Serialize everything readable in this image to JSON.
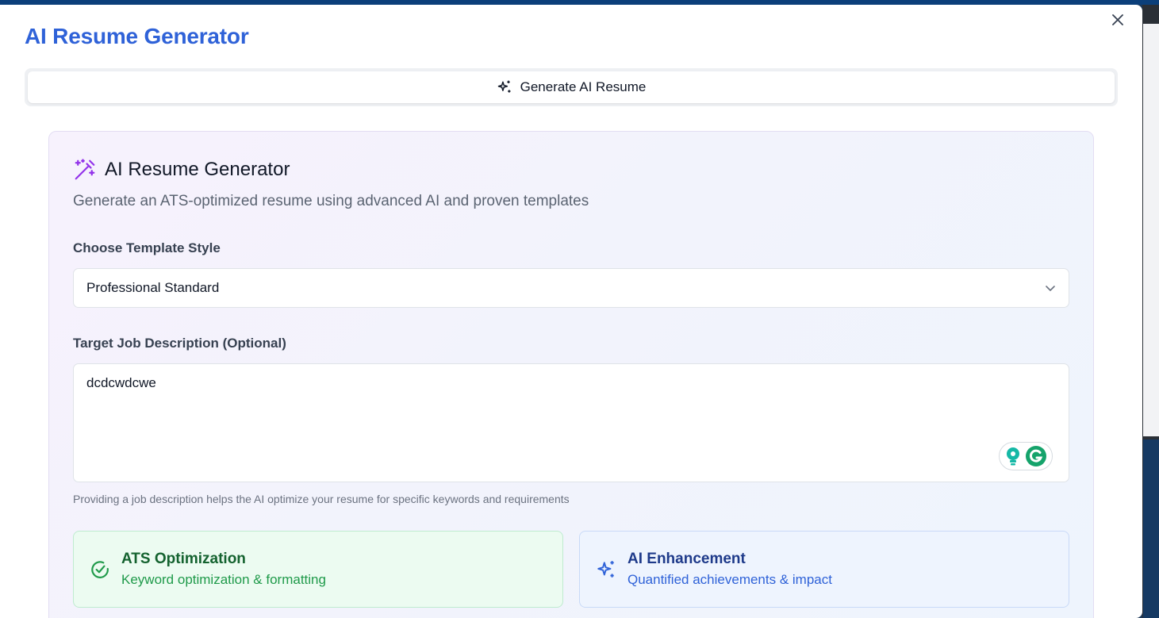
{
  "modal": {
    "title": "AI Resume Generator",
    "close_label": "×"
  },
  "tabs": [
    {
      "label": "Generate AI Resume",
      "icon": "sparkles-icon",
      "active": true
    }
  ],
  "card": {
    "title": "AI Resume Generator",
    "icon": "magic-wand-icon",
    "subtitle": "Generate an ATS-optimized resume using advanced AI and proven templates"
  },
  "template": {
    "label": "Choose Template Style",
    "selected": "Professional Standard"
  },
  "job_description": {
    "label": "Target Job Description (Optional)",
    "value": "dcdcwdcwe",
    "helper": "Providing a job description helps the AI optimize your resume for specific keywords and requirements"
  },
  "features": [
    {
      "title": "ATS Optimization",
      "description": "Keyword optimization & formatting",
      "icon": "check-circle-icon"
    },
    {
      "title": "AI Enhancement",
      "description": "Quantified achievements & impact",
      "icon": "sparkles-icon"
    }
  ],
  "colors": {
    "accent": "#2f62d8",
    "ats_green": "#1f9a4a",
    "wand_purple": "#9333ea"
  }
}
